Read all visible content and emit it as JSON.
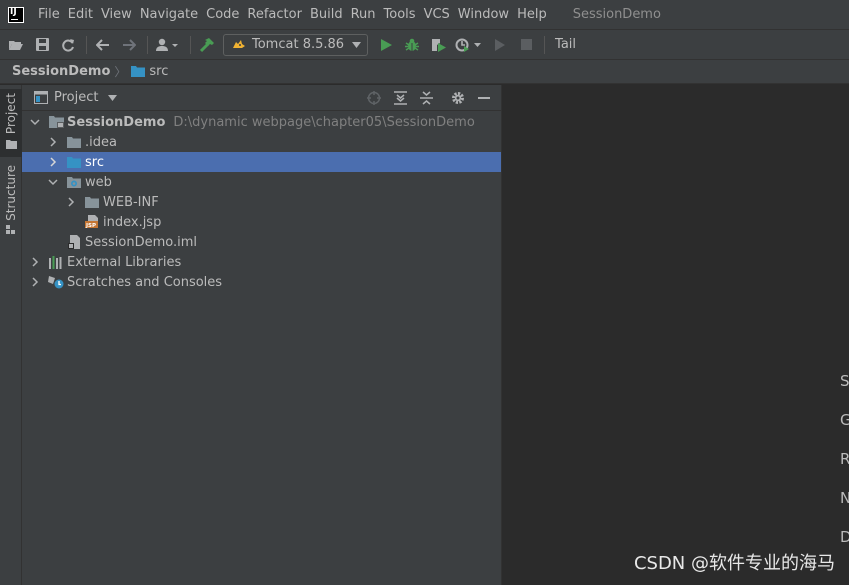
{
  "window": {
    "title": "SessionDemo"
  },
  "menu": [
    {
      "label": "File"
    },
    {
      "label": "Edit"
    },
    {
      "label": "View"
    },
    {
      "label": "Navigate"
    },
    {
      "label": "Code"
    },
    {
      "label": "Refactor"
    },
    {
      "label": "Build"
    },
    {
      "label": "Run"
    },
    {
      "label": "Tools"
    },
    {
      "label": "VCS"
    },
    {
      "label": "Window"
    },
    {
      "label": "Help"
    }
  ],
  "toolbar": {
    "run_config": "Tomcat 8.5.86",
    "tail_label": "Tail"
  },
  "breadcrumbs": {
    "root": "SessionDemo",
    "child": "src"
  },
  "sidebar": {
    "project_tab": "Project",
    "structure_tab": "Structure"
  },
  "project_panel": {
    "title": "Project",
    "tree": {
      "root": {
        "name": "SessionDemo",
        "path": "D:\\dynamic webpage\\chapter05\\SessionDemo"
      },
      "idea": ".idea",
      "src": "src",
      "web": "web",
      "web_inf": "WEB-INF",
      "index": "index.jsp",
      "iml": "SessionDemo.iml",
      "ext_libs": "External Libraries",
      "scratches": "Scratches and Consoles"
    }
  },
  "editor": {
    "hints": [
      "S",
      "G",
      "R",
      "N",
      "D"
    ]
  },
  "watermark": "CSDN @软件专业的海马",
  "colors": {
    "selection": "#4b6eaf",
    "folder": "#87939a",
    "source_folder": "#3592c4",
    "run_green": "#499c54",
    "jsp_orange": "#c57633"
  }
}
